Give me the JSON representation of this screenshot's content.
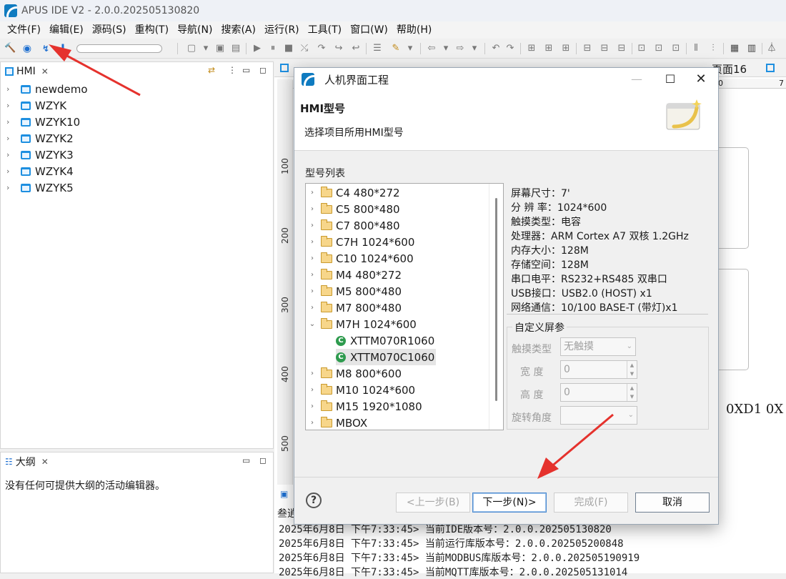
{
  "window": {
    "title": "APUS IDE V2 - 2.0.0.202505130820"
  },
  "menu": [
    "文件(F)",
    "编辑(E)",
    "源码(S)",
    "重构(T)",
    "导航(N)",
    "搜索(A)",
    "运行(R)",
    "工具(T)",
    "窗口(W)",
    "帮助(H)"
  ],
  "hmi_panel": {
    "title": "HMI",
    "projects": [
      "newdemo",
      "WZYK",
      "WZYK10",
      "WZYK2",
      "WZYK3",
      "WZYK4",
      "WZYK5"
    ]
  },
  "outline_panel": {
    "title": "大纲",
    "message": "没有任何可提供大纲的活动编辑器。"
  },
  "editor": {
    "tabs": [
      "页面16"
    ],
    "ruler_top": [
      "00",
      "7"
    ],
    "ruler_left": [
      "100",
      "200",
      "300",
      "400",
      "500"
    ],
    "canvas_text": "0XD1 0X"
  },
  "console": {
    "header": "叁逍",
    "lines": [
      "2025年6月8日 下午7:33:45> 当前IDE版本号：2.0.0.202505130820",
      "2025年6月8日 下午7:33:45> 当前运行库版本号：2.0.0.202505200848",
      "2025年6月8日 下午7:33:45> 当前MODBUS库版本号：2.0.0.202505190919",
      "2025年6月8日 下午7:33:45> 当前MQTT库版本号：2.0.0.202505131014"
    ]
  },
  "dialog": {
    "title": "人机界面工程",
    "header_title": "HMI型号",
    "header_desc": "选择项目所用HMI型号",
    "list_label": "型号列表",
    "models": [
      {
        "label": "C4 480*272",
        "type": "folder",
        "expanded": false
      },
      {
        "label": "C5 800*480",
        "type": "folder",
        "expanded": false
      },
      {
        "label": "C7 800*480",
        "type": "folder",
        "expanded": false
      },
      {
        "label": "C7H 1024*600",
        "type": "folder",
        "expanded": false
      },
      {
        "label": "C10 1024*600",
        "type": "folder",
        "expanded": false
      },
      {
        "label": "M4 480*272",
        "type": "folder",
        "expanded": false
      },
      {
        "label": "M5 800*480",
        "type": "folder",
        "expanded": false
      },
      {
        "label": "M7 800*480",
        "type": "folder",
        "expanded": false
      },
      {
        "label": "M7H 1024*600",
        "type": "folder",
        "expanded": true
      },
      {
        "label": "XTTM070R1060",
        "type": "model",
        "selected": false
      },
      {
        "label": "XTTM070C1060",
        "type": "model",
        "selected": true
      },
      {
        "label": "M8 800*600",
        "type": "folder",
        "expanded": false
      },
      {
        "label": "M10 1024*600",
        "type": "folder",
        "expanded": false
      },
      {
        "label": "M15 1920*1080",
        "type": "folder",
        "expanded": false
      },
      {
        "label": "MBOX",
        "type": "folder",
        "expanded": false
      }
    ],
    "specs": [
      "屏幕尺寸：7'",
      "分 辨 率：1024*600",
      "触摸类型：电容",
      "处理器：ARM Cortex A7 双核 1.2GHz",
      "内存大小：128M",
      "存储空间：128M",
      "串口电平：RS232+RS485 双串口",
      "USB接口：USB2.0 (HOST) x1",
      "网络通信：10/100 BASE-T (带灯)x1"
    ],
    "custom": {
      "legend": "自定义屏参",
      "touch_label": "触摸类型",
      "touch_value": "无触摸",
      "width_label": "宽 度",
      "width_value": "0",
      "height_label": "高 度",
      "height_value": "0",
      "rotate_label": "旋转角度",
      "rotate_value": ""
    },
    "buttons": {
      "back": "<上一步(B)",
      "next": "下一步(N)>",
      "finish": "完成(F)",
      "cancel": "取消"
    }
  },
  "colors": {
    "accent": "#1e8fe0",
    "arrow": "#e5322d",
    "selection": "#e5e5e5"
  }
}
